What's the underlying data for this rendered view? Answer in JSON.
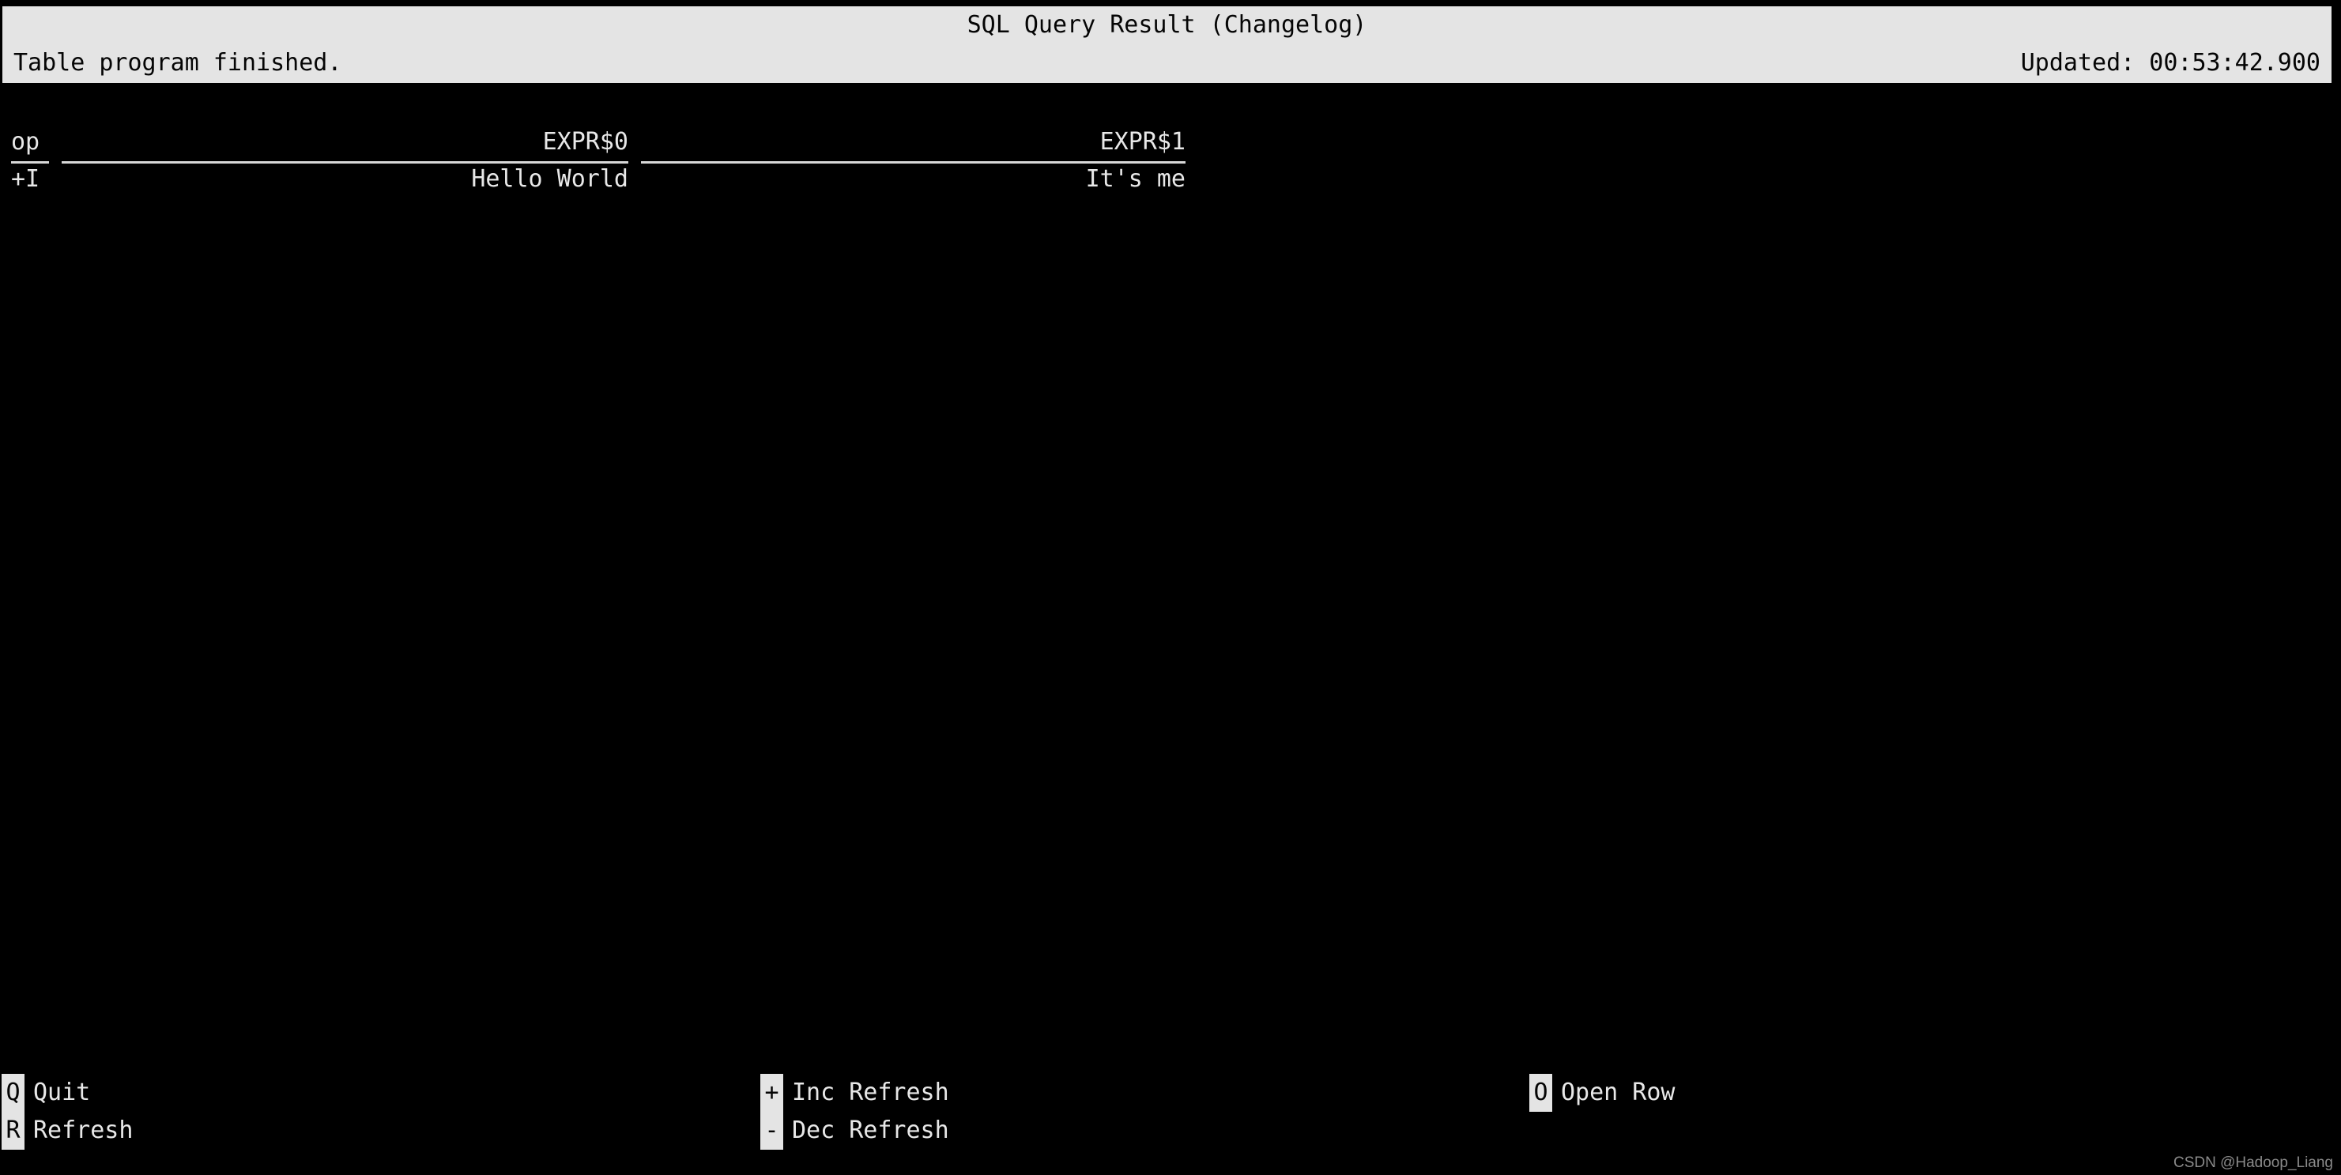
{
  "header": {
    "title": "SQL Query Result (Changelog)",
    "status_message": "Table program finished.",
    "updated_label": "Updated: 00:53:42.900",
    "background_color": "#e4e4e4",
    "text_color": "#050505"
  },
  "table": {
    "columns": [
      {
        "key": "op",
        "label": "op",
        "align": "left"
      },
      {
        "key": "expr0",
        "label": "EXPR$0",
        "align": "right"
      },
      {
        "key": "expr1",
        "label": "EXPR$1",
        "align": "right"
      }
    ],
    "rows": [
      {
        "op": "+I",
        "expr0": "Hello World",
        "expr1": "It's me"
      }
    ],
    "row_count": 1
  },
  "footer": {
    "groups": [
      {
        "name": "navigation",
        "keys": [
          {
            "key": "Q",
            "label": "Quit"
          },
          {
            "key": "R",
            "label": "Refresh"
          }
        ]
      },
      {
        "name": "refresh-rate",
        "keys": [
          {
            "key": "+",
            "label": "Inc Refresh"
          },
          {
            "key": "-",
            "label": "Dec Refresh"
          }
        ]
      },
      {
        "name": "row-actions",
        "keys": [
          {
            "key": "O",
            "label": "Open Row"
          }
        ]
      }
    ],
    "key_background_color": "#e4e4e4",
    "key_text_color": "#050505"
  },
  "watermark": {
    "text": "CSDN @Hadoop_Liang"
  },
  "terminal": {
    "background_color": "#000000",
    "foreground_color": "#e8e8e8"
  }
}
